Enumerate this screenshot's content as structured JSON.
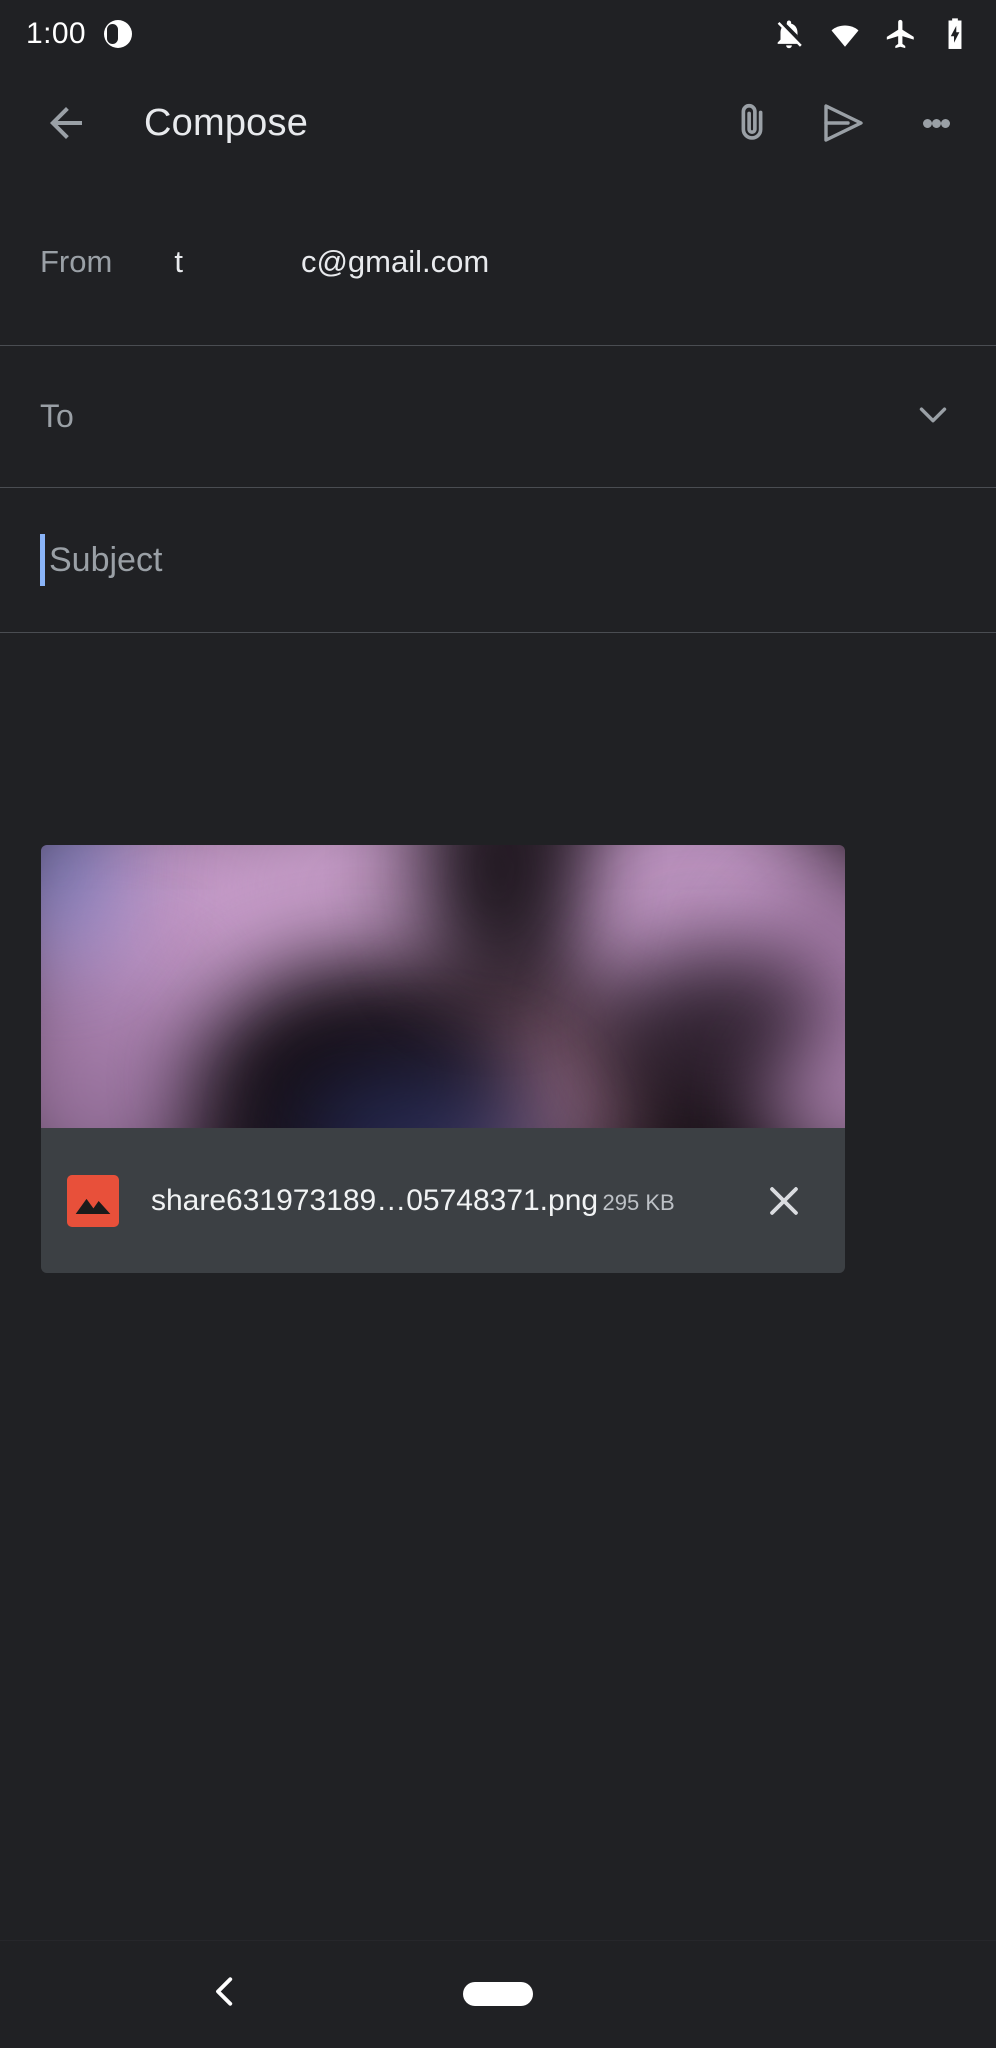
{
  "status_bar": {
    "time": "1:00",
    "left_icons": [
      {
        "name": "notification-dot-icon"
      }
    ],
    "right_icons": [
      {
        "name": "notifications-off-icon"
      },
      {
        "name": "wifi-icon"
      },
      {
        "name": "airplane-mode-icon"
      },
      {
        "name": "battery-charging-icon"
      }
    ]
  },
  "app_bar": {
    "back_label": "Back",
    "title": "Compose",
    "actions": [
      {
        "name": "attach-file-button",
        "label": "Attach file"
      },
      {
        "name": "send-button",
        "label": "Send"
      },
      {
        "name": "more-options-button",
        "label": "More options"
      }
    ]
  },
  "compose": {
    "from": {
      "label": "From",
      "value_part1": "t",
      "value_part2": "c@gmail.com"
    },
    "to": {
      "placeholder": "To",
      "value": "",
      "expand_label": "Expand recipients"
    },
    "subject": {
      "placeholder": "Subject",
      "value": "",
      "caret_color": "#8ab4f8"
    },
    "body": {
      "placeholder": "",
      "value": ""
    }
  },
  "attachment": {
    "file_name": "share631973189…05748371.png",
    "file_size": "295 KB",
    "icon_name": "image-file-icon",
    "icon_color": "#e8503a",
    "remove_label": "Remove attachment",
    "preview_alt": "Blurred purple photo preview"
  },
  "nav_bar": {
    "back_label": "Back",
    "home_label": "Home"
  },
  "theme": {
    "background": "#202124",
    "surface": "#3c4044",
    "divider": "#4a4d52",
    "text_primary": "#e8eaed",
    "text_secondary": "#9aa0a6",
    "accent": "#8ab4f8"
  }
}
